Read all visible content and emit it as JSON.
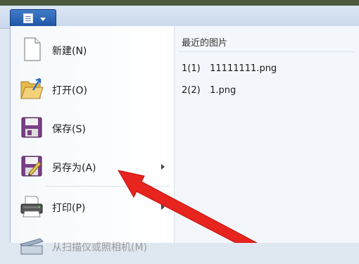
{
  "menu": {
    "items": [
      {
        "label": "新建(N)",
        "icon": "new-file-icon"
      },
      {
        "label": "打开(O)",
        "icon": "open-folder-icon"
      },
      {
        "label": "保存(S)",
        "icon": "save-floppy-icon"
      },
      {
        "label": "另存为(A)",
        "icon": "save-as-icon"
      },
      {
        "label": "打印(P)",
        "icon": "printer-icon"
      },
      {
        "label": "从扫描仪或照相机(M)",
        "icon": "scanner-icon"
      }
    ]
  },
  "recent": {
    "title": "最近的图片",
    "items": [
      {
        "index": "1(1)",
        "name": "11111111.png"
      },
      {
        "index": "2(2)",
        "name": "1.png"
      }
    ]
  },
  "annotation": {
    "color": "#e8241f",
    "icon": "red-pointer-arrow"
  }
}
